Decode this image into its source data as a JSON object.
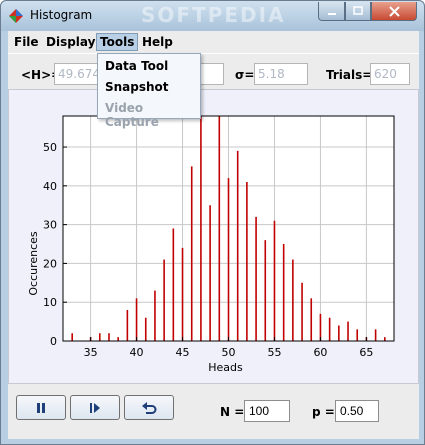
{
  "window": {
    "title": "Histogram",
    "watermark": "SOFTPEDIA",
    "colors": {
      "frame": "#b8cfe3",
      "close": "#c74a32"
    }
  },
  "menubar": {
    "file": "File",
    "display": "Display",
    "tools": "Tools",
    "help": "Help"
  },
  "tools_menu": {
    "data_tool": "Data Tool",
    "snapshot": "Snapshot",
    "video_capture": "Video Capture"
  },
  "stats": {
    "mean_label": "<H>=",
    "mean_value": "49.67419354838",
    "sigma_label": "σ=",
    "sigma_value": "5.18",
    "trials_label": "Trials=",
    "trials_value": "620"
  },
  "controls": {
    "pause_icon": "pause-icon",
    "step_icon": "step-forward-icon",
    "reset_icon": "reset-icon",
    "n_label": "N =",
    "n_value": "100",
    "p_label": "p =",
    "p_value": "0.50"
  },
  "chart_data": {
    "type": "bar",
    "xlabel": "Heads",
    "ylabel": "Occurences",
    "xlim": [
      32,
      68
    ],
    "ylim": [
      0,
      58
    ],
    "xticks": [
      35,
      40,
      45,
      50,
      55,
      60,
      65
    ],
    "yticks": [
      0,
      10,
      20,
      30,
      40,
      50
    ],
    "grid": true,
    "bar_color": "#c00000",
    "x": [
      33,
      35,
      36,
      37,
      38,
      39,
      40,
      41,
      42,
      43,
      44,
      45,
      46,
      47,
      48,
      49,
      50,
      51,
      52,
      53,
      54,
      55,
      56,
      57,
      58,
      59,
      60,
      61,
      62,
      63,
      64,
      65,
      66,
      67
    ],
    "values": [
      2,
      1,
      2,
      2,
      1,
      8,
      11,
      6,
      13,
      21,
      29,
      24,
      45,
      58,
      35,
      58,
      42,
      49,
      41,
      32,
      26,
      31,
      25,
      21,
      15,
      11,
      7,
      6,
      4,
      5,
      3,
      1,
      3,
      1
    ]
  }
}
